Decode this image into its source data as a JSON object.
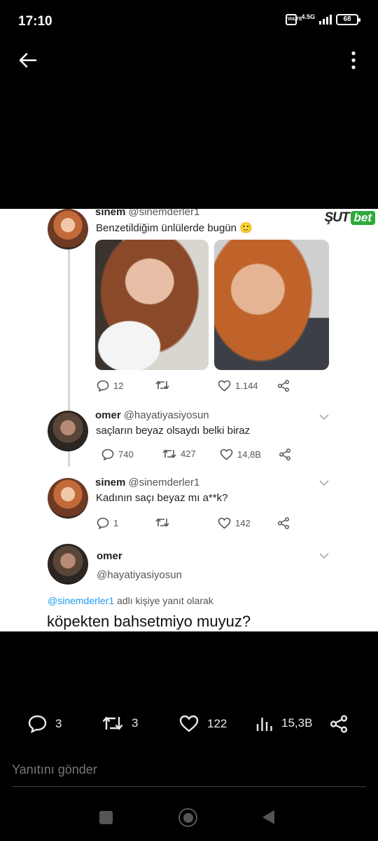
{
  "status_bar": {
    "time": "17:10",
    "volte": "Vo LTE",
    "network": "4.5G",
    "battery": "68"
  },
  "screenshot": {
    "watermark": {
      "part1": "ŞUT",
      "part2": "bet"
    },
    "tweets": [
      {
        "name": "sinem",
        "handle": "@sinemderler1",
        "text": "Benzetildiğim ünlülerde bugün 🙂",
        "replies": "12",
        "retweets": "",
        "likes": "1.144"
      },
      {
        "name": "omer",
        "handle": "@hayatiyasiyosun",
        "text": "saçların beyaz olsaydı belki biraz",
        "replies": "740",
        "retweets": "427",
        "likes": "14,8B"
      },
      {
        "name": "sinem",
        "handle": "@sinemderler1",
        "text": "Kadının saçı beyaz mı a**k?",
        "replies": "1",
        "retweets": "",
        "likes": "142"
      }
    ],
    "final_tweet": {
      "name": "omer",
      "handle": "@hayatiyasiyosun",
      "reply_mention": "@sinemderler1",
      "reply_suffix": " adlı kişiye yanıt olarak",
      "text": "köpekten bahsetmiyo muyuz?"
    }
  },
  "actions": {
    "replies": "3",
    "retweets": "3",
    "likes": "122",
    "views": "15,3B"
  },
  "reply_box": {
    "placeholder": "Yanıtını gönder"
  },
  "colors": {
    "background": "#000000",
    "accent": "#1d9bf0",
    "watermark_green": "#2eaa3c"
  }
}
